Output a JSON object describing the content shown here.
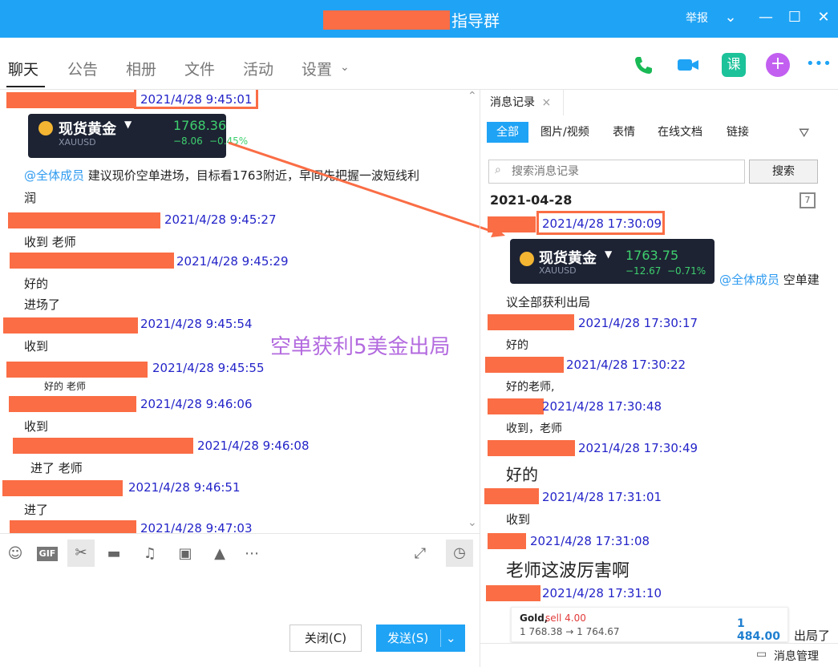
{
  "title": {
    "text": "指导群",
    "report": "举报"
  },
  "nav": {
    "tabs": [
      "聊天",
      "公告",
      "相册",
      "文件",
      "活动",
      "设置"
    ],
    "more": "•••"
  },
  "gold_card_left": {
    "name": "现货黄金",
    "sub": "XAUUSD",
    "price": "1768.36",
    "chg1": "−8.06",
    "chg2": "−0.45%"
  },
  "left_messages": [
    {
      "ts": "2021/4/28 9:45:01"
    },
    {
      "mention": "@全体成员",
      "text": " 建议现价空单进场，目标看1763附近，早间先把握一波短线利",
      "text2": "润"
    },
    {
      "ts": "2021/4/28 9:45:27",
      "text": "收到  老师"
    },
    {
      "ts": "2021/4/28 9:45:29",
      "text": "好的",
      "text2": "进场了"
    },
    {
      "ts": "2021/4/28 9:45:54",
      "text": "收到"
    },
    {
      "ts": "2021/4/28 9:45:55",
      "text": "好的   老师"
    },
    {
      "ts": "2021/4/28 9:46:06",
      "text": "收到"
    },
    {
      "ts": "2021/4/28 9:46:08",
      "text": "进了 老师"
    },
    {
      "ts": "2021/4/28 9:46:51",
      "text": "进了"
    },
    {
      "ts": "2021/4/28 9:47:03"
    }
  ],
  "overlay": "空单获利5美金出局",
  "buttons": {
    "close": "关闭(C)",
    "send": "发送(S)"
  },
  "right": {
    "tab": "消息记录",
    "filters": [
      "全部",
      "图片/视频",
      "表情",
      "在线文档",
      "链接"
    ],
    "search_placeholder": "搜索消息记录",
    "search_btn": "搜索",
    "date": "2021-04-28",
    "gold_card": {
      "name": "现货黄金",
      "sub": "XAUUSD",
      "price": "1763.75",
      "chg1": "−12.67",
      "chg2": "−0.71%"
    },
    "messages": [
      {
        "ts": "2021/4/28 17:30:09"
      },
      {
        "mention": "@全体成员",
        "text": " 空单建",
        "text2": "议全部获利出局"
      },
      {
        "ts": "2021/4/28 17:30:17",
        "text": "好的"
      },
      {
        "ts": "2021/4/28 17:30:22",
        "text": "好的老师,"
      },
      {
        "ts": "2021/4/28 17:30:48",
        "text": "收到，老师"
      },
      {
        "ts": "2021/4/28 17:30:49",
        "text": "好的"
      },
      {
        "ts": "2021/4/28 17:31:01",
        "text": "收到"
      },
      {
        "ts": "2021/4/28 17:31:08",
        "text": "老师这波厉害啊"
      },
      {
        "ts": "2021/4/28 17:31:10"
      }
    ],
    "mini_card": {
      "name": "Gold,",
      "sell": "sell 4.00",
      "prices": "1 768.38 → 1 764.67",
      "profit": "1 484.00"
    },
    "tail_text": "出局了",
    "manage": "消息管理"
  },
  "colors": {
    "titlebar": "#1fa3f5",
    "accent": "#1fa3f5",
    "redaction": "#fa6d45",
    "timestamp": "#2424c9",
    "mention": "#2f9bf0",
    "overlay": "#b36adf",
    "green": "#3ecf6e"
  }
}
